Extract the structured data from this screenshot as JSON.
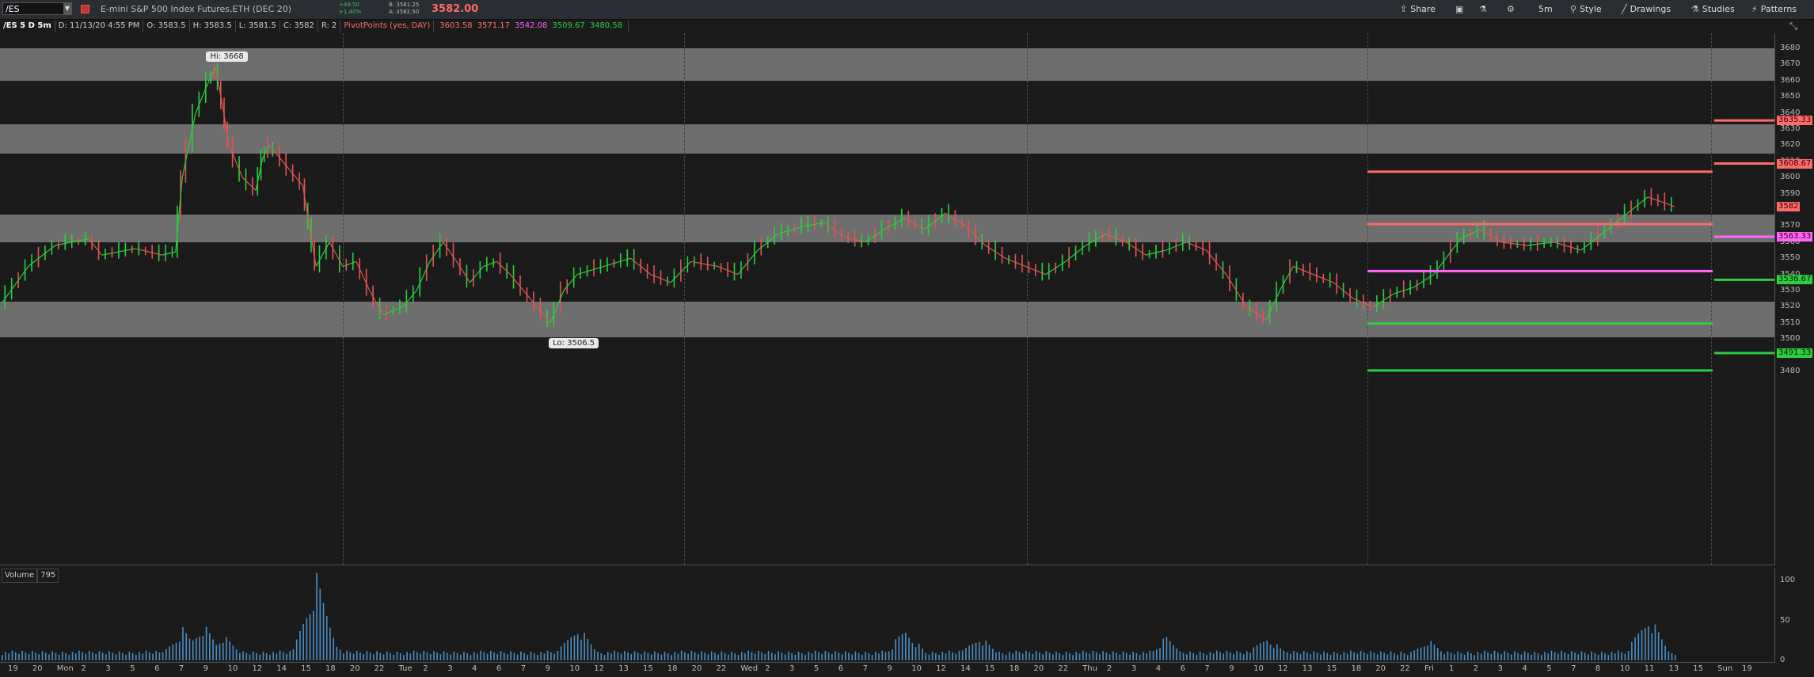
{
  "toolbar": {
    "symbol": "/ES",
    "description": "E-mini S&P 500 Index Futures,ETH (DEC 20)",
    "change_line1": "+49.50",
    "change_line2": "+1.40%",
    "bid_line1": "B: 3581.25",
    "bid_line2": "A: 3582.50",
    "last_price": "3582.00",
    "share": "Share",
    "interval": "5m",
    "style": "Style",
    "drawings": "Drawings",
    "studies": "Studies",
    "patterns": "Patterns"
  },
  "infobar": {
    "chart_label": "/ES 5 D 5m",
    "date": "D: 11/13/20 4:55 PM",
    "open": "O: 3583.5",
    "high": "H: 3583.5",
    "low": "L: 3581.5",
    "close": "C: 3582",
    "range": "R: 2",
    "study": "PivotPoints (yes, DAY)",
    "pivots": [
      {
        "text": "3603.58",
        "color": "#ff6b6b"
      },
      {
        "text": "3571.17",
        "color": "#ff6b6b"
      },
      {
        "text": "3542.08",
        "color": "#ff66ff"
      },
      {
        "text": "3509.67",
        "color": "#2ecc40"
      },
      {
        "text": "3480.58",
        "color": "#2ecc40"
      }
    ]
  },
  "chart_data": {
    "type": "line",
    "y_ticks": [
      "3680",
      "3670",
      "3660",
      "3650",
      "3640",
      "3630",
      "3620",
      "3610",
      "3600",
      "3590",
      "3580",
      "3570",
      "3560",
      "3550",
      "3540",
      "3530",
      "3520",
      "3510",
      "3500",
      "3490",
      "3480"
    ],
    "ylim": [
      3472,
      3682
    ],
    "x_ticks": [
      "19",
      "20",
      "Mon",
      "2",
      "3",
      "5",
      "6",
      "7",
      "9",
      "10",
      "12",
      "14",
      "15",
      "18",
      "20",
      "22",
      "Tue",
      "2",
      "3",
      "4",
      "6",
      "7",
      "9",
      "10",
      "12",
      "13",
      "15",
      "18",
      "20",
      "22",
      "Wed",
      "2",
      "3",
      "5",
      "6",
      "7",
      "9",
      "10",
      "12",
      "14",
      "15",
      "18",
      "20",
      "22",
      "Thu",
      "2",
      "3",
      "4",
      "6",
      "7",
      "9",
      "10",
      "12",
      "13",
      "15",
      "18",
      "20",
      "22",
      "Fri",
      "1",
      "2",
      "3",
      "4",
      "5",
      "7",
      "8",
      "10",
      "11",
      "13",
      "15",
      "Sun",
      "19"
    ],
    "high_callout": "Hi: 3668",
    "low_callout": "Lo: 3506.5",
    "gray_zones": [
      [
        3660,
        3680
      ],
      [
        3615,
        3633
      ],
      [
        3560,
        3577
      ],
      [
        3501,
        3523
      ]
    ],
    "pivot_lines_today": [
      {
        "value": 3603.58,
        "color": "#ff6b6b"
      },
      {
        "value": 3571.17,
        "color": "#ff6b6b"
      },
      {
        "value": 3542.08,
        "color": "#ff66ff"
      },
      {
        "value": 3509.67,
        "color": "#2ecc40"
      },
      {
        "value": 3480.58,
        "color": "#2ecc40"
      }
    ],
    "next_pivot_labels": [
      {
        "text": "3635.33",
        "value": 3635.33,
        "color": "#ff6b6b"
      },
      {
        "text": "3608.67",
        "value": 3608.67,
        "color": "#ff6b6b"
      },
      {
        "text": "3582",
        "value": 3582,
        "color": "#ff6b6b"
      },
      {
        "text": "3563.33",
        "value": 3563.33,
        "color": "#ff66ff"
      },
      {
        "text": "3536.67",
        "value": 3536.67,
        "color": "#2ecc40"
      },
      {
        "text": "3491.33",
        "value": 3491.33,
        "color": "#2ecc40"
      }
    ],
    "price_path": [
      [
        0,
        3522
      ],
      [
        4,
        3545
      ],
      [
        8,
        3558
      ],
      [
        13,
        3562
      ],
      [
        15,
        3552
      ],
      [
        20,
        3556
      ],
      [
        24,
        3552
      ],
      [
        26,
        3554
      ],
      [
        27,
        3600
      ],
      [
        29,
        3640
      ],
      [
        31,
        3660
      ],
      [
        32,
        3668
      ],
      [
        33,
        3645
      ],
      [
        34,
        3620
      ],
      [
        36,
        3600
      ],
      [
        38,
        3592
      ],
      [
        39,
        3612
      ],
      [
        40,
        3620
      ],
      [
        43,
        3605
      ],
      [
        45,
        3595
      ],
      [
        46,
        3570
      ],
      [
        47,
        3545
      ],
      [
        49,
        3560
      ],
      [
        51,
        3545
      ],
      [
        53,
        3548
      ],
      [
        55,
        3530
      ],
      [
        57,
        3515
      ],
      [
        60,
        3520
      ],
      [
        62,
        3530
      ],
      [
        64,
        3548
      ],
      [
        66,
        3560
      ],
      [
        68,
        3548
      ],
      [
        70,
        3535
      ],
      [
        72,
        3545
      ],
      [
        74,
        3548
      ],
      [
        76,
        3540
      ],
      [
        79,
        3525
      ],
      [
        82,
        3510
      ],
      [
        84,
        3530
      ],
      [
        86,
        3540
      ],
      [
        90,
        3545
      ],
      [
        94,
        3550
      ],
      [
        97,
        3540
      ],
      [
        100,
        3535
      ],
      [
        103,
        3548
      ],
      [
        107,
        3545
      ],
      [
        110,
        3540
      ],
      [
        113,
        3555
      ],
      [
        116,
        3565
      ],
      [
        120,
        3570
      ],
      [
        123,
        3572
      ],
      [
        126,
        3563
      ],
      [
        129,
        3560
      ],
      [
        132,
        3568
      ],
      [
        135,
        3575
      ],
      [
        138,
        3568
      ],
      [
        141,
        3578
      ],
      [
        144,
        3570
      ],
      [
        147,
        3558
      ],
      [
        150,
        3550
      ],
      [
        153,
        3545
      ],
      [
        156,
        3540
      ],
      [
        159,
        3548
      ],
      [
        162,
        3558
      ],
      [
        165,
        3565
      ],
      [
        168,
        3560
      ],
      [
        171,
        3552
      ],
      [
        174,
        3555
      ],
      [
        177,
        3560
      ],
      [
        180,
        3555
      ],
      [
        183,
        3540
      ],
      [
        186,
        3520
      ],
      [
        189,
        3512
      ],
      [
        191,
        3530
      ],
      [
        193,
        3545
      ],
      [
        196,
        3540
      ],
      [
        199,
        3535
      ],
      [
        202,
        3525
      ],
      [
        205,
        3520
      ],
      [
        208,
        3528
      ],
      [
        211,
        3532
      ],
      [
        214,
        3540
      ],
      [
        218,
        3562
      ],
      [
        221,
        3568
      ],
      [
        224,
        3560
      ],
      [
        228,
        3558
      ],
      [
        232,
        3560
      ],
      [
        236,
        3555
      ],
      [
        240,
        3568
      ],
      [
        243,
        3578
      ],
      [
        246,
        3588
      ],
      [
        248,
        3585
      ],
      [
        250,
        3582
      ]
    ],
    "volume_axis": [
      "100",
      "50",
      "0"
    ],
    "volume_bursts": [
      [
        27,
        0.38
      ],
      [
        30,
        0.45
      ],
      [
        33,
        0.3
      ],
      [
        47,
        1.0
      ],
      [
        86,
        0.42
      ],
      [
        135,
        0.38
      ],
      [
        146,
        0.3
      ],
      [
        174,
        0.28
      ],
      [
        189,
        0.3
      ],
      [
        213,
        0.25
      ],
      [
        246,
        0.55
      ]
    ]
  },
  "volume": {
    "label": "Volume",
    "value": "795"
  }
}
